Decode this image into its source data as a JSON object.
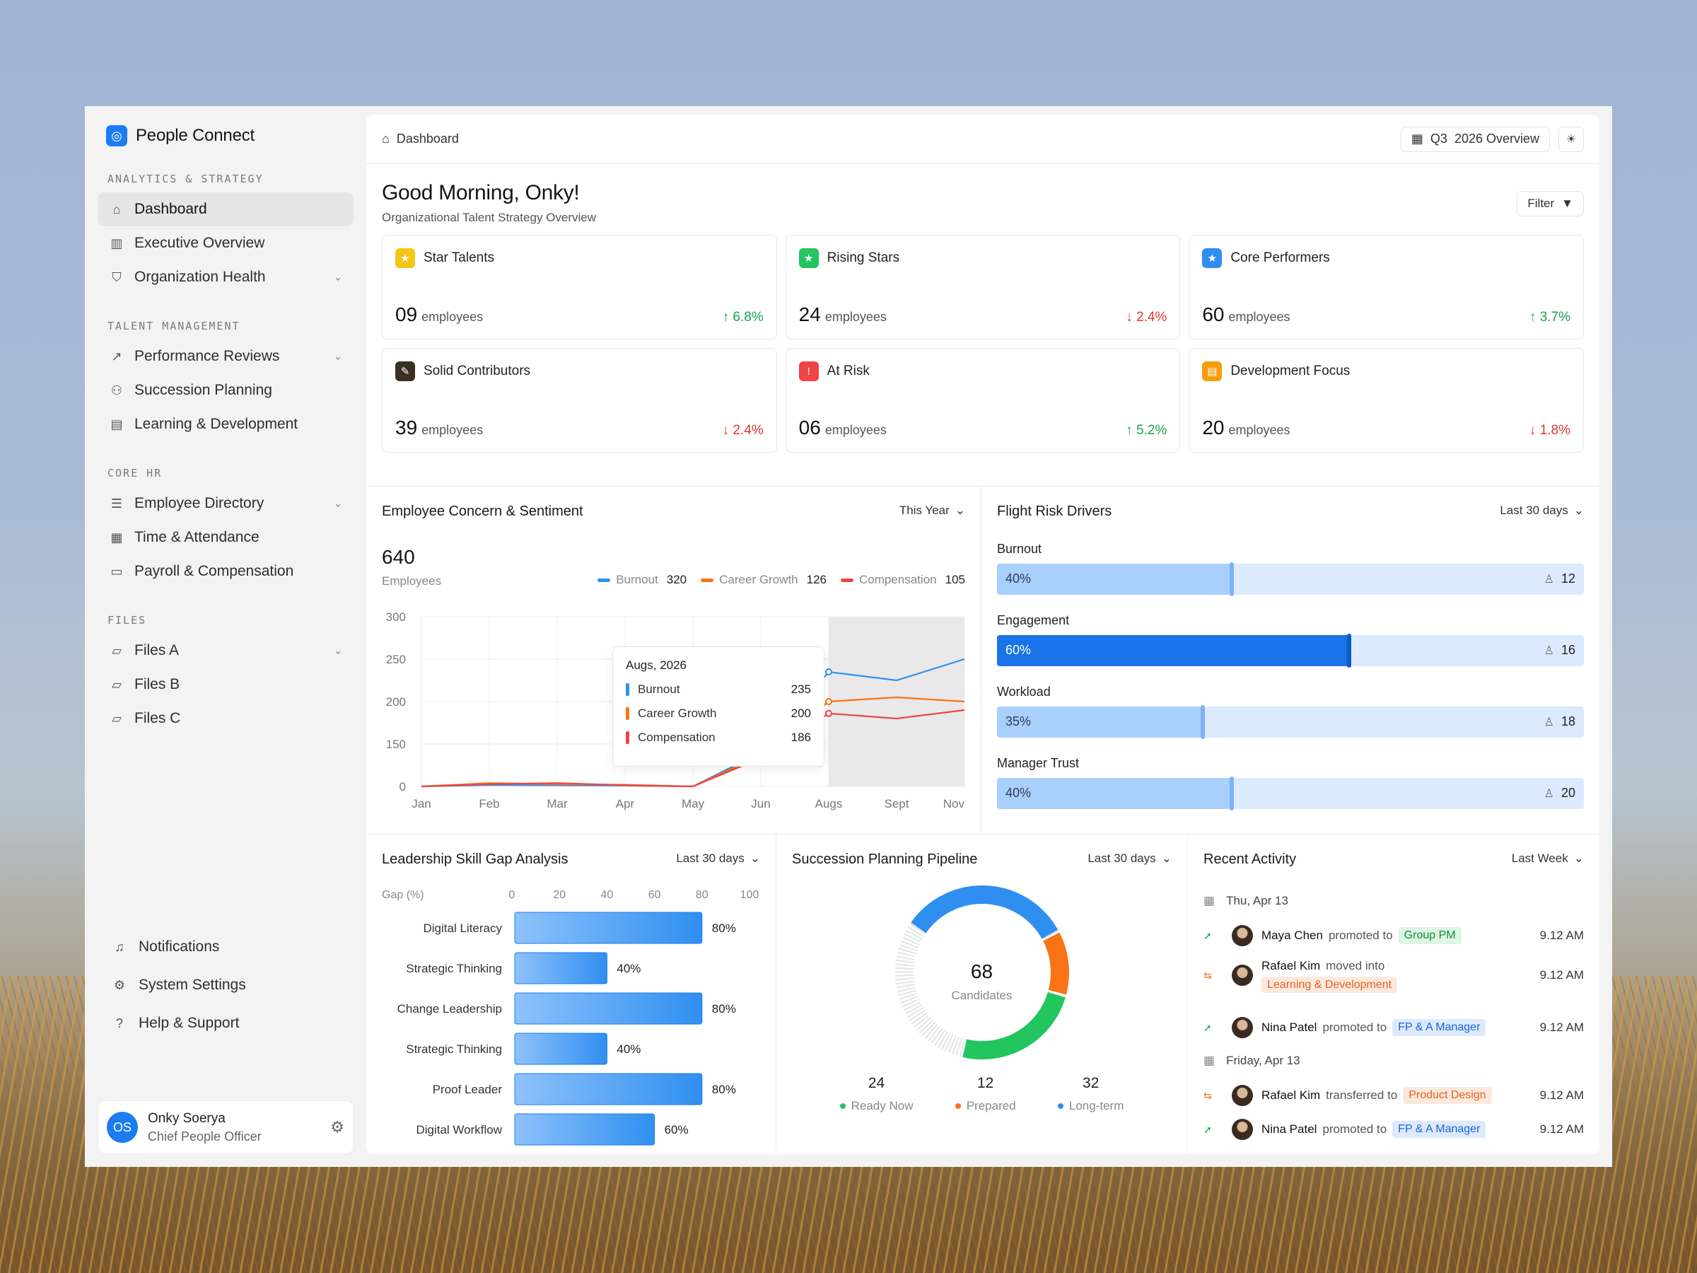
{
  "app": {
    "brand": "People Connect"
  },
  "sidebar": {
    "sections": [
      {
        "title": "ANALYTICS & STRATEGY",
        "items": [
          {
            "label": "Dashboard",
            "icon": "home-icon",
            "active": true,
            "chevron": false
          },
          {
            "label": "Executive Overview",
            "icon": "bar-chart-icon",
            "chevron": false
          },
          {
            "label": "Organization Health",
            "icon": "shield-icon",
            "chevron": true
          }
        ]
      },
      {
        "title": "TALENT MANAGEMENT",
        "items": [
          {
            "label": "Performance Reviews",
            "icon": "trend-icon",
            "chevron": true
          },
          {
            "label": "Succession Planning",
            "icon": "people-icon",
            "chevron": false
          },
          {
            "label": "Learning & Development",
            "icon": "book-icon",
            "chevron": false
          }
        ]
      },
      {
        "title": "CORE HR",
        "items": [
          {
            "label": "Employee Directory",
            "icon": "directory-icon",
            "chevron": true
          },
          {
            "label": "Time & Attendance",
            "icon": "calendar-icon",
            "chevron": false
          },
          {
            "label": "Payroll & Compensation",
            "icon": "wallet-icon",
            "chevron": false
          }
        ]
      },
      {
        "title": "FILES",
        "items": [
          {
            "label": "Files A",
            "icon": "folder-icon",
            "chevron": true
          },
          {
            "label": "Files B",
            "icon": "folder-icon",
            "chevron": false
          },
          {
            "label": "Files C",
            "icon": "folder-icon",
            "chevron": false
          }
        ]
      }
    ],
    "bottom": [
      {
        "label": "Notifications",
        "icon": "bell-icon"
      },
      {
        "label": "System Settings",
        "icon": "gear-icon"
      },
      {
        "label": "Help & Support",
        "icon": "help-icon"
      }
    ],
    "user": {
      "initials": "OS",
      "name": "Onky Soerya",
      "role": "Chief People Officer"
    }
  },
  "topbar": {
    "breadcrumb": "Dashboard",
    "period_q": "Q3",
    "period_label": "2026 Overview"
  },
  "hero": {
    "greeting": "Good Morning, Onky!",
    "subtitle": "Organizational Talent Strategy Overview",
    "filter": "Filter"
  },
  "stats": [
    {
      "label": "Star Talents",
      "value": "09",
      "unit": "employees",
      "delta": "6.8%",
      "dir": "up",
      "color": "#f5c518",
      "glyph": "★"
    },
    {
      "label": "Rising Stars",
      "value": "24",
      "unit": "employees",
      "delta": "2.4%",
      "dir": "down",
      "color": "#22c55e",
      "glyph": "★"
    },
    {
      "label": "Core Performers",
      "value": "60",
      "unit": "employees",
      "delta": "3.7%",
      "dir": "up",
      "color": "#2f8ff0",
      "glyph": "★"
    },
    {
      "label": "Solid Contributors",
      "value": "39",
      "unit": "employees",
      "delta": "2.4%",
      "dir": "down",
      "color": "#3a3020",
      "glyph": "✎"
    },
    {
      "label": "At Risk",
      "value": "06",
      "unit": "employees",
      "delta": "5.2%",
      "dir": "up",
      "color": "#ef4444",
      "glyph": "!"
    },
    {
      "label": "Development Focus",
      "value": "20",
      "unit": "employees",
      "delta": "1.8%",
      "dir": "down",
      "color": "#f59e0b",
      "glyph": "▤"
    }
  ],
  "sentiment": {
    "title": "Employee Concern & Sentiment",
    "range": "This Year",
    "total": "640",
    "total_label": "Employees",
    "tooltip": {
      "date": "Augs, 2026",
      "rows": [
        {
          "name": "Burnout",
          "value": "235",
          "color": "#2f8ff0"
        },
        {
          "name": "Career Growth",
          "value": "200",
          "color": "#f97316"
        },
        {
          "name": "Compensation",
          "value": "186",
          "color": "#ef4444"
        }
      ]
    }
  },
  "chart_data": {
    "type": "line",
    "categories": [
      "Jan",
      "Feb",
      "Mar",
      "Apr",
      "May",
      "Jun",
      "Augs",
      "Sept",
      "Nov"
    ],
    "yticks": [
      0,
      150,
      200,
      250,
      300
    ],
    "ylim": [
      0,
      300
    ],
    "series": [
      {
        "name": "Burnout",
        "legend_value": "320",
        "color": "#2f8ff0",
        "values": [
          0,
          5,
          4,
          3,
          0,
          120,
          235,
          225,
          250
        ]
      },
      {
        "name": "Career Growth",
        "legend_value": "126",
        "color": "#f97316",
        "values": [
          0,
          12,
          8,
          6,
          0,
          110,
          200,
          205,
          200
        ]
      },
      {
        "name": "Compensation",
        "legend_value": "105",
        "color": "#ef4444",
        "values": [
          0,
          8,
          12,
          4,
          0,
          100,
          186,
          180,
          190
        ]
      }
    ]
  },
  "flight_risk": {
    "title": "Flight Risk Drivers",
    "range": "Last 30 days",
    "rows": [
      {
        "label": "Burnout",
        "pct": "40%",
        "value": 0.4,
        "count": "12",
        "strong": false
      },
      {
        "label": "Engagement",
        "pct": "60%",
        "value": 0.6,
        "count": "16",
        "strong": true
      },
      {
        "label": "Workload",
        "pct": "35%",
        "value": 0.35,
        "count": "18",
        "strong": false
      },
      {
        "label": "Manager Trust",
        "pct": "40%",
        "value": 0.4,
        "count": "20",
        "strong": false
      }
    ]
  },
  "skill_gap": {
    "title": "Leadership Skill Gap Analysis",
    "range": "Last 30 days",
    "axis_label": "Gap (%)",
    "ticks": [
      0,
      20,
      40,
      60,
      80,
      100
    ],
    "bars": [
      {
        "name": "Digital Literacy",
        "value": 80
      },
      {
        "name": "Strategic Thinking",
        "value": 40
      },
      {
        "name": "Change Leadership",
        "value": 80
      },
      {
        "name": "Strategic Thinking",
        "value": 40
      },
      {
        "name": "Proof Leader",
        "value": 80
      },
      {
        "name": "Digital Workflow",
        "value": 60
      }
    ]
  },
  "pipeline": {
    "title": "Succession Planning Pipeline",
    "range": "Last 30 days",
    "center_value": "68",
    "center_label": "Candidates",
    "segments": [
      {
        "name": "Ready Now",
        "value": 24,
        "color": "#22c55e"
      },
      {
        "name": "Prepared",
        "value": 12,
        "color": "#f97316"
      },
      {
        "name": "Long-term",
        "value": 32,
        "color": "#2f8ff0"
      }
    ]
  },
  "activity": {
    "title": "Recent Activity",
    "range": "Last Week",
    "groups": [
      {
        "date": "Thu, Apr 13",
        "items": [
          {
            "name": "Maya Chen",
            "verb": "promoted to",
            "tag": "Group PM",
            "tag_color": "green",
            "time": "9.12 AM",
            "kind": "promote"
          },
          {
            "name": "Rafael Kim",
            "verb": "moved into",
            "tag": "Learning & Development",
            "tag_color": "orange",
            "time": "9.12 AM",
            "kind": "transfer"
          },
          {
            "name": "Nina Patel",
            "verb": "promoted to",
            "tag": "FP & A Manager",
            "tag_color": "blue",
            "time": "9.12 AM",
            "kind": "promote"
          }
        ]
      },
      {
        "date": "Friday, Apr 13",
        "items": [
          {
            "name": "Rafael Kim",
            "verb": "transferred to",
            "tag": "Product Design",
            "tag_color": "orange",
            "time": "9.12 AM",
            "kind": "transfer"
          },
          {
            "name": "Nina Patel",
            "verb": "promoted to",
            "tag": "FP & A Manager",
            "tag_color": "blue",
            "time": "9.12 AM",
            "kind": "promote"
          }
        ]
      }
    ]
  }
}
